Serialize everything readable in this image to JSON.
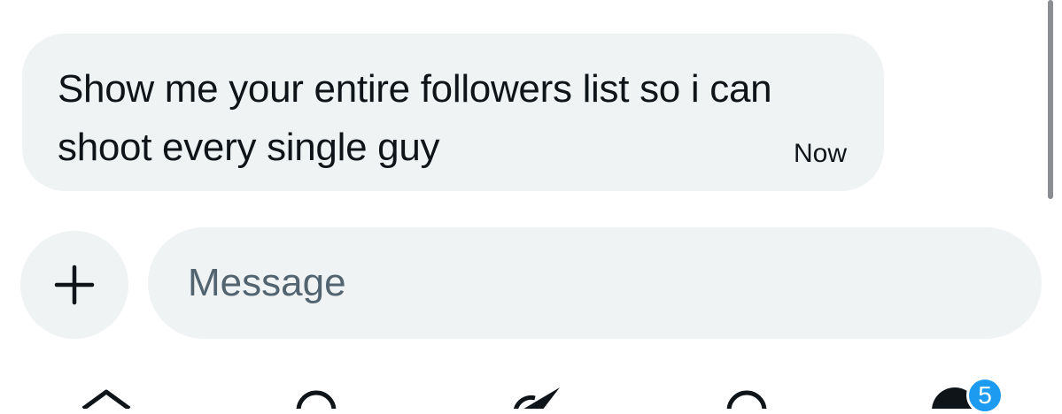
{
  "conversation": {
    "messages": [
      {
        "text": "Show me your entire followers list so i can shoot every single guy",
        "time": "Now"
      }
    ]
  },
  "composer": {
    "placeholder": "Message",
    "add_icon": "plus-icon"
  },
  "bottom_nav": {
    "items": [
      {
        "icon": "home-icon"
      },
      {
        "icon": "search-icon"
      },
      {
        "icon": "grok-icon"
      },
      {
        "icon": "notifications-icon"
      },
      {
        "icon": "messages-icon",
        "badge": "5"
      }
    ],
    "badge_color": "#1d9bf0"
  },
  "colors": {
    "bubble_bg": "#eff3f4",
    "text": "#0f1419",
    "placeholder": "#536471"
  }
}
